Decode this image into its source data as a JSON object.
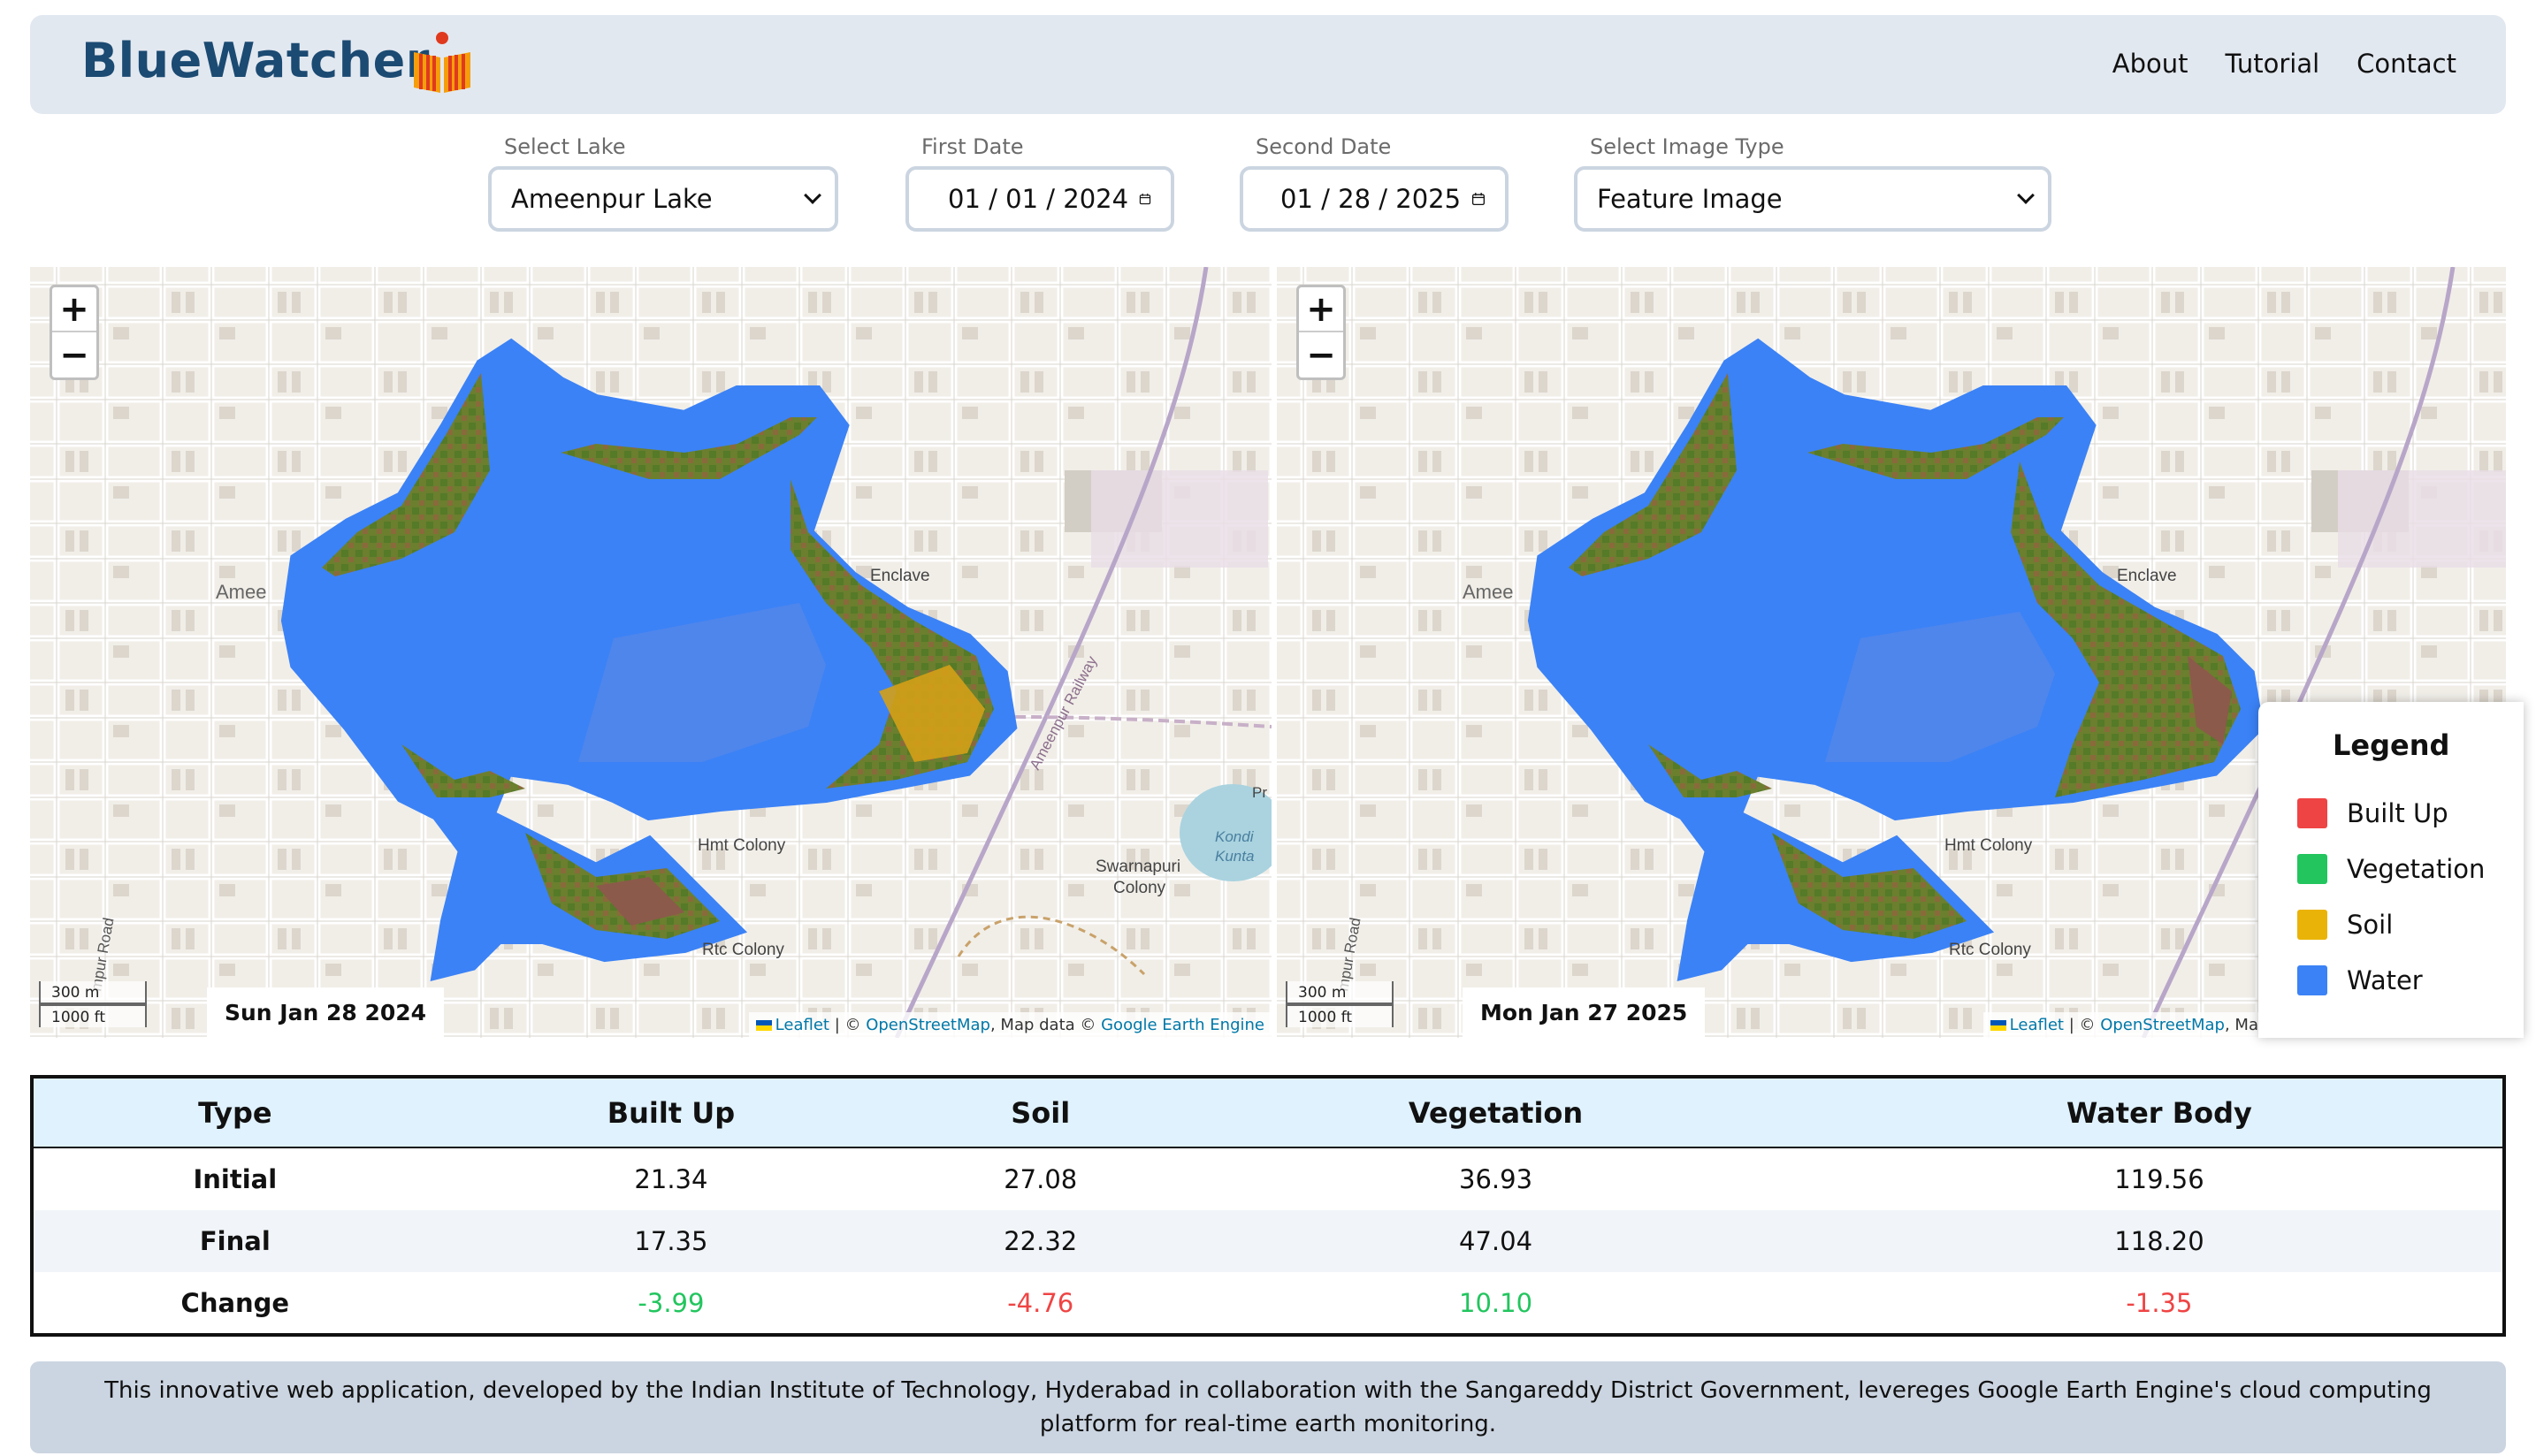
{
  "header": {
    "brand": "BlueWatcher",
    "nav": [
      "About",
      "Tutorial",
      "Contact"
    ]
  },
  "controls": {
    "lake": {
      "label": "Select Lake",
      "value": "Ameenpur Lake"
    },
    "first_date": {
      "label": "First Date",
      "month": "01",
      "day": "01",
      "year": "2024"
    },
    "second_date": {
      "label": "Second Date",
      "month": "01",
      "day": "28",
      "year": "2025"
    },
    "image_type": {
      "label": "Select Image Type",
      "value": "Feature Image"
    }
  },
  "maps": {
    "left": {
      "date": "Sun Jan 28 2024"
    },
    "right": {
      "date": "Mon Jan 27 2025"
    },
    "scale_m": "300 m",
    "scale_ft": "1000 ft",
    "attribution": {
      "leaflet": "Leaflet",
      "sep1": " | © ",
      "osm": "OpenStreetMap",
      "sep2": ", Map data © ",
      "gee": "Google Earth Engine"
    },
    "place_labels": {
      "enclave": "Enclave",
      "hmt": "Hmt Colony",
      "rtc": "Rtc Colony",
      "swarnapuri": "Swarnapuri",
      "colony": "Colony",
      "kondi": "Kondi",
      "kunta": "Kunta",
      "amee": "Amee",
      "road": "mpur Road",
      "pr": "Pr",
      "railway": "Ameenpur Railway"
    }
  },
  "legend": {
    "title": "Legend",
    "items": [
      {
        "label": "Built Up",
        "color": "#ef4444"
      },
      {
        "label": "Vegetation",
        "color": "#22c55e"
      },
      {
        "label": "Soil",
        "color": "#eab308"
      },
      {
        "label": "Water",
        "color": "#3b82f6"
      }
    ]
  },
  "table": {
    "headers": [
      "Type",
      "Built Up",
      "Soil",
      "Vegetation",
      "Water Body"
    ],
    "rows": [
      {
        "type": "Initial",
        "built_up": "21.34",
        "soil": "27.08",
        "vegetation": "36.93",
        "water": "119.56"
      },
      {
        "type": "Final",
        "built_up": "17.35",
        "soil": "22.32",
        "vegetation": "47.04",
        "water": "118.20"
      },
      {
        "type": "Change",
        "built_up": "-3.99",
        "soil": "-4.76",
        "vegetation": "10.10",
        "water": "-1.35"
      }
    ]
  },
  "footer": "This innovative web application, developed by the Indian Institute of Technology, Hyderabad in collaboration with the Sangareddy District Government, levereges Google Earth Engine's cloud computing platform for real-time earth monitoring."
}
